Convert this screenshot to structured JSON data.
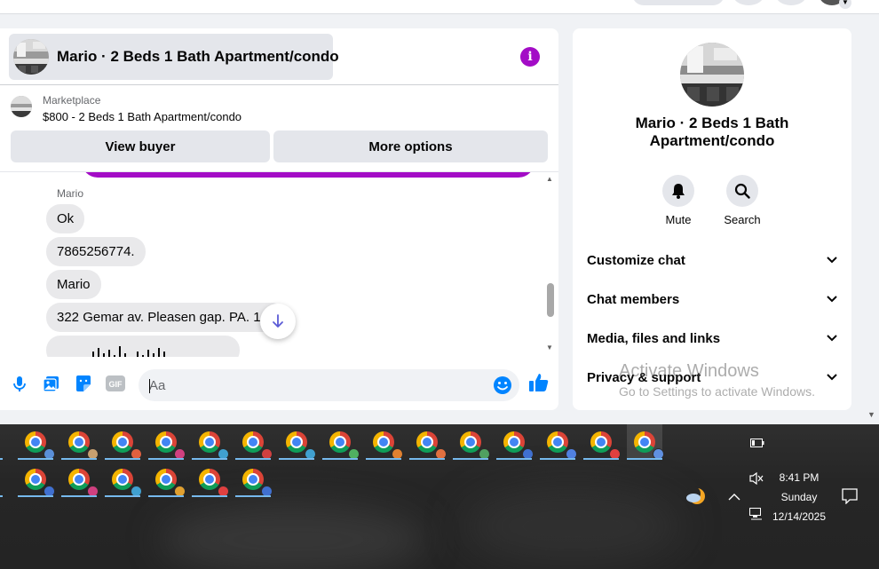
{
  "colors": {
    "accent": "#a30cc6",
    "messenger_blue": "#0084ff",
    "bubble_gray": "#e9e9eb",
    "taskbar": "#262626"
  },
  "chat": {
    "header": {
      "title": "Mario · 2 Beds 1 Bath Apartment/condo",
      "info_icon": "info-icon"
    },
    "marketplace": {
      "label": "Marketplace",
      "listing": "$800 - 2 Beds 1 Bath Apartment/condo",
      "view_buyer": "View buyer",
      "more_options": "More options"
    },
    "sender_name": "Mario",
    "messages": [
      {
        "text": "Ok"
      },
      {
        "text": "7865256774."
      },
      {
        "text": "Mario"
      },
      {
        "text": "322 Gemar av. Pleasen gap. PA. 168"
      }
    ],
    "composer": {
      "placeholder": "Aa",
      "icons": [
        "microphone-icon",
        "photo-icon",
        "sticker-icon",
        "gif-icon",
        "emoji-icon",
        "thumbs-up-icon"
      ],
      "gif_label": "GIF"
    }
  },
  "info_panel": {
    "name": "Mario · 2 Beds 1 Bath Apartment/condo",
    "actions": [
      {
        "label": "Mute",
        "icon": "bell-icon"
      },
      {
        "label": "Search",
        "icon": "search-icon"
      }
    ],
    "sections": [
      {
        "label": "Customize chat"
      },
      {
        "label": "Chat members"
      },
      {
        "label": "Media, files and links"
      },
      {
        "label": "Privacy & support"
      }
    ]
  },
  "watermark": {
    "line1": "Activate Windows",
    "line2": "Go to Settings to activate Windows."
  },
  "taskbar": {
    "row1_badge_colors": [
      "#5a8fd8",
      "#c8a070",
      "#e06040",
      "#d04080",
      "#40a0d0",
      "#d04040",
      "#40a0d0",
      "#50b060",
      "#e08030",
      "#e07040",
      "#50a060",
      "#4070d0",
      "#5080e0",
      "#e04040",
      "#6090e0"
    ],
    "row2_badge_colors": [
      "#4070d0",
      "#d04080",
      "#40a0d0",
      "#e0a030",
      "#e04040",
      "#4070d0"
    ],
    "tray": {
      "time": "8:41 PM",
      "day": "Sunday",
      "date": "12/14/2025",
      "icons": [
        "battery-icon",
        "volume-muted-icon",
        "network-icon",
        "chevron-up-icon",
        "weather-icon",
        "notification-icon"
      ]
    }
  }
}
